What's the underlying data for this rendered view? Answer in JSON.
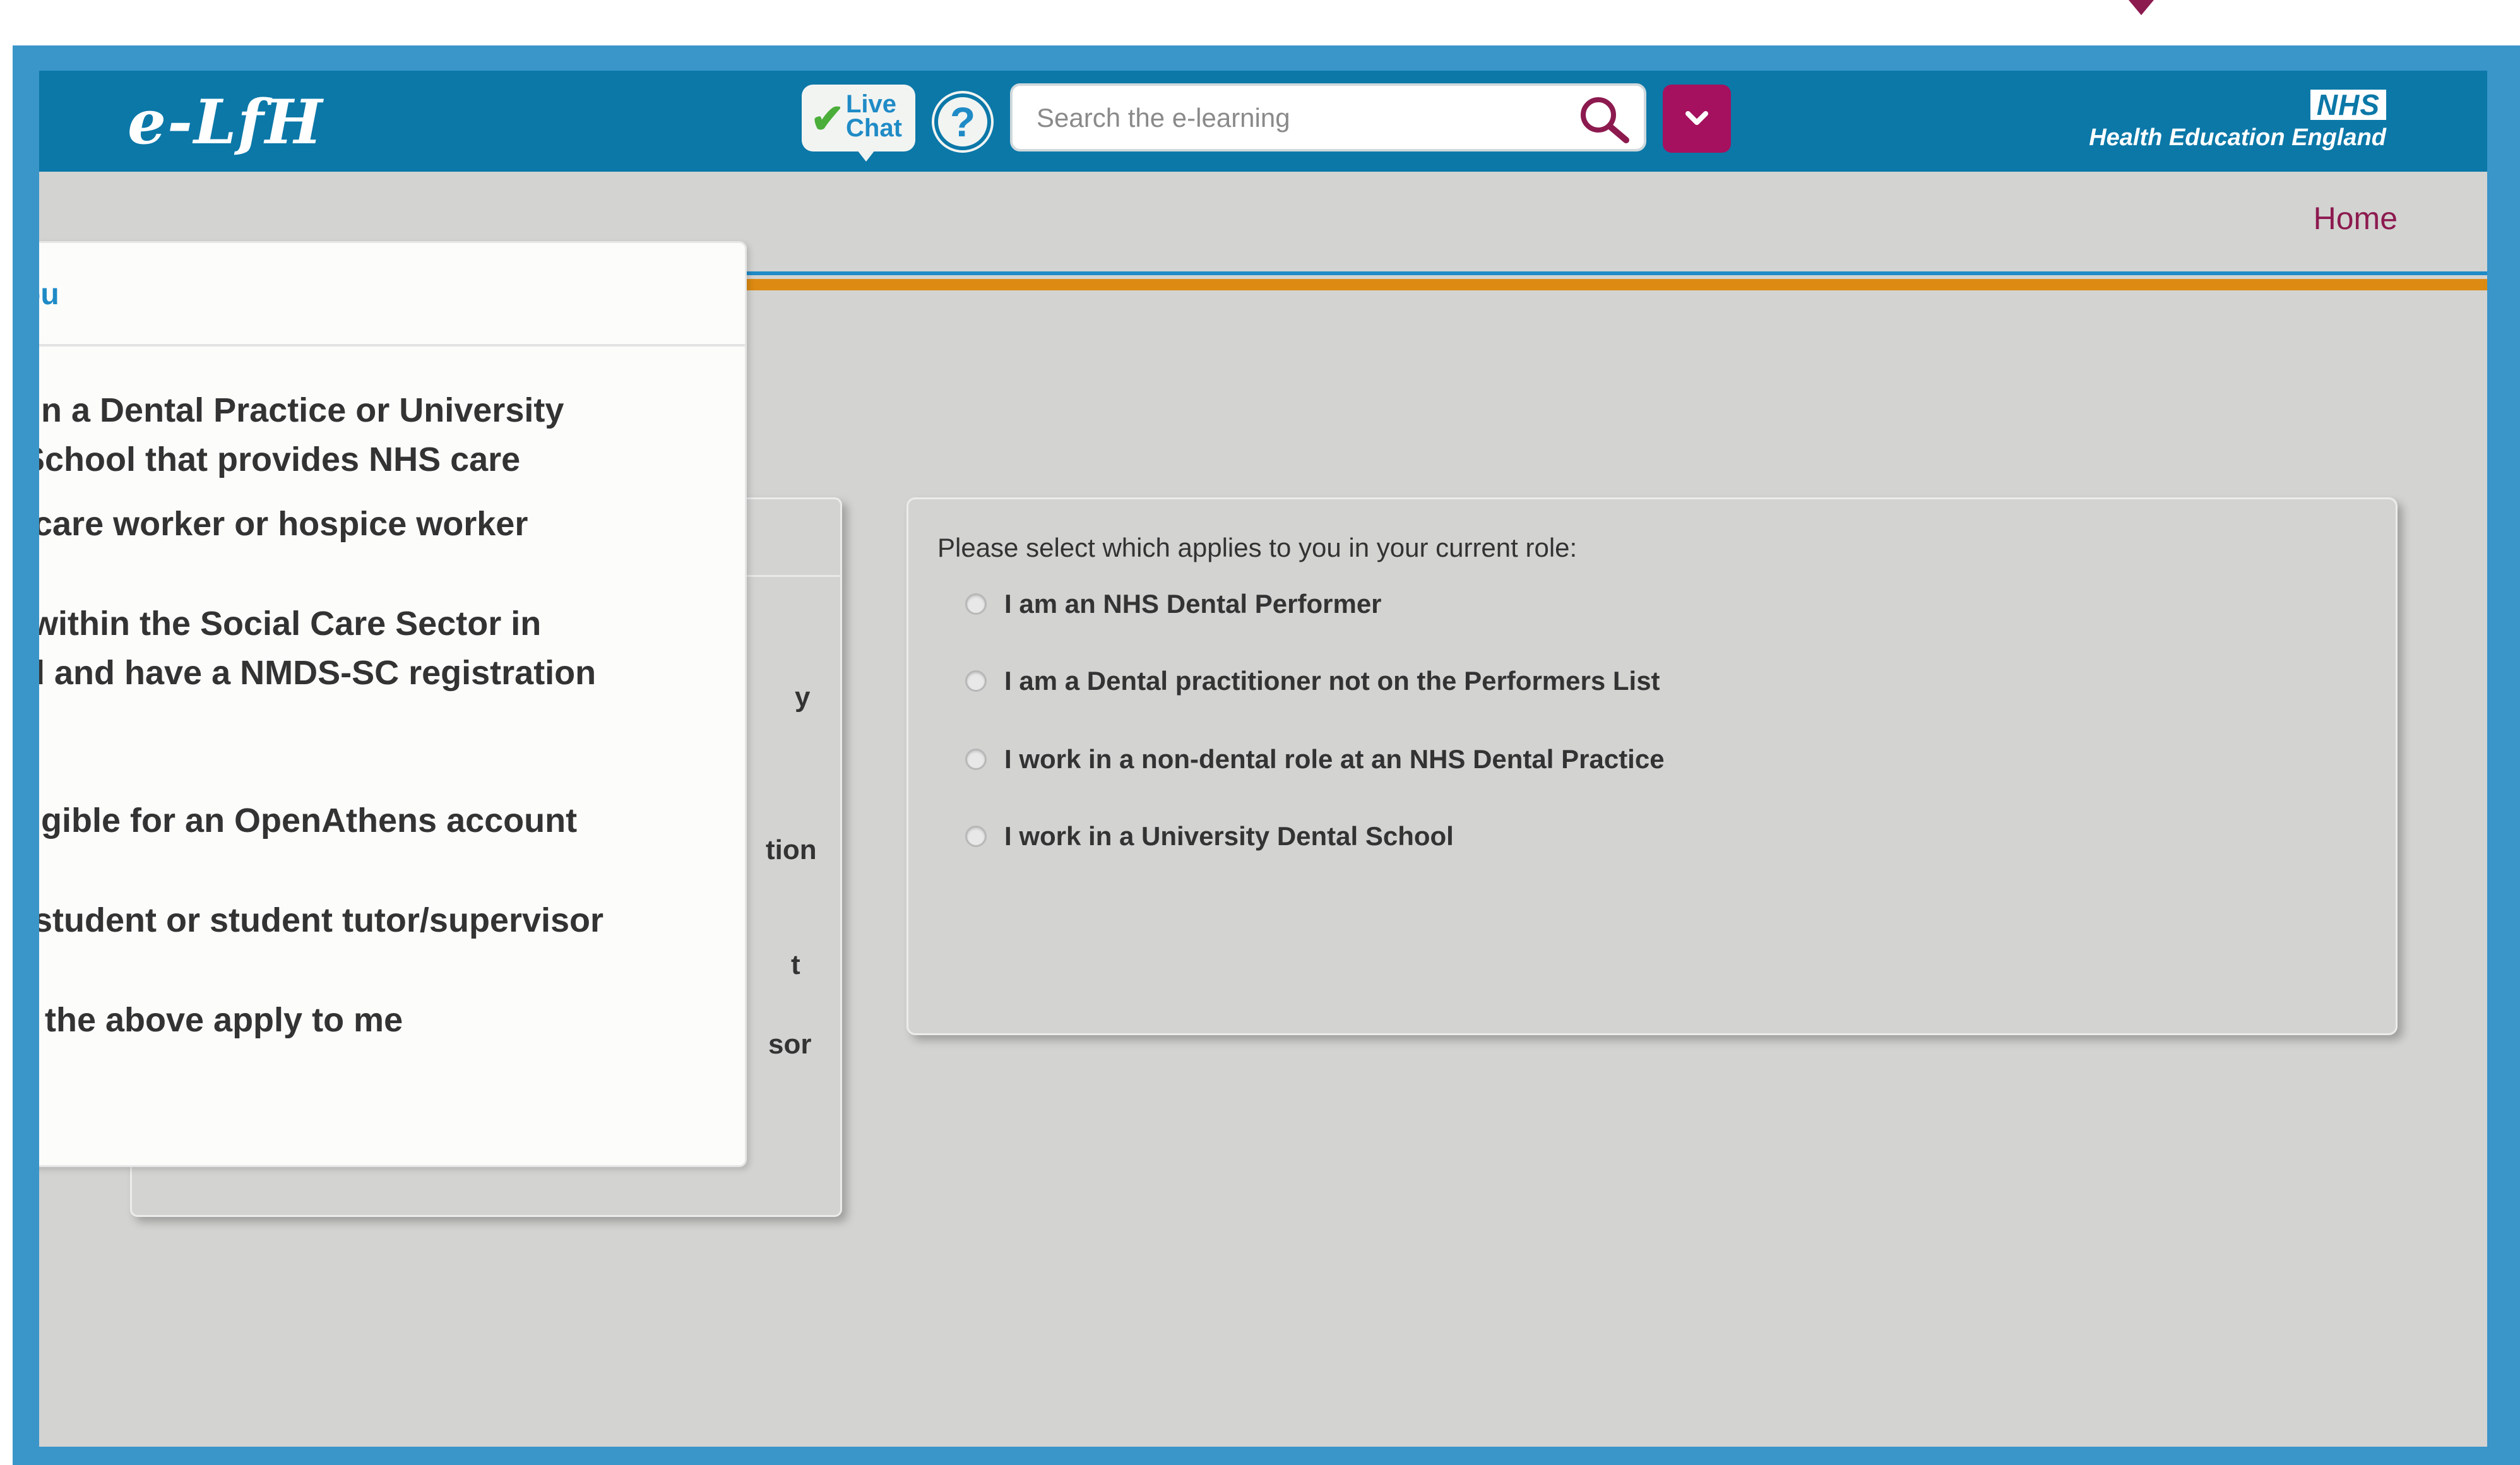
{
  "header": {
    "logo_text": "e-LfH",
    "live_chat_label": "Live Chat",
    "help_symbol": "?",
    "search_placeholder": "Search the e-learning",
    "nhs_logo_text": "NHS",
    "org_name": "Health Education England"
  },
  "nav": {
    "home_label": "Home"
  },
  "popup": {
    "title_fragment": "ou",
    "options": [
      "k in a Dental Practice or University\nl School that provides NHS care",
      "n care worker or hospice worker",
      "k within the Social Care Sector in\nnd and have a NMDS-SC registration",
      "eligible for an OpenAthens account",
      "n student or student tutor/supervisor",
      "of the above apply to me"
    ]
  },
  "left_panel": {
    "visible_fragments": [
      "y",
      "tion",
      "t",
      "sor"
    ]
  },
  "right_panel": {
    "prompt": "Please select which applies to you in your current role:",
    "options": [
      "I am an NHS Dental Performer",
      "I am a Dental practitioner not on the Performers List",
      "I work in a non-dental role at an NHS Dental Practice",
      "I work in a University Dental School"
    ]
  },
  "colors": {
    "header_blue": "#0b78a8",
    "frame_blue": "#3a95c9",
    "accent_magenta": "#a5115e",
    "home_link": "#8c1a4f",
    "divider_orange": "#dd8a12",
    "page_gray": "#d3d3d1",
    "popup_title_blue": "#1f8bc6"
  },
  "icons": {
    "live_chat": "check-chat-bubble-icon",
    "help": "question-mark-icon",
    "search": "magnifier-icon",
    "dropdown": "chevron-down-icon"
  }
}
